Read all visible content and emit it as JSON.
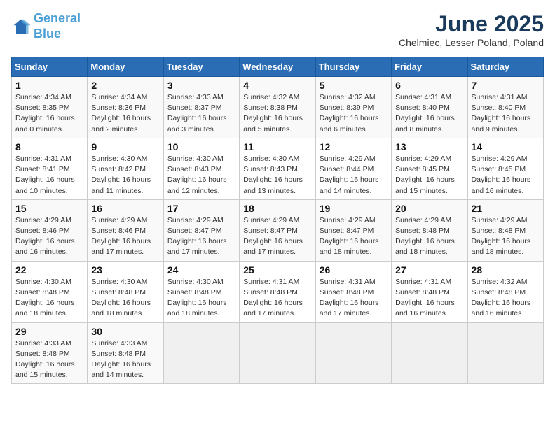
{
  "header": {
    "logo_line1": "General",
    "logo_line2": "Blue",
    "month": "June 2025",
    "location": "Chelmiec, Lesser Poland, Poland"
  },
  "weekdays": [
    "Sunday",
    "Monday",
    "Tuesday",
    "Wednesday",
    "Thursday",
    "Friday",
    "Saturday"
  ],
  "weeks": [
    [
      {
        "day": "1",
        "info": "Sunrise: 4:34 AM\nSunset: 8:35 PM\nDaylight: 16 hours\nand 0 minutes."
      },
      {
        "day": "2",
        "info": "Sunrise: 4:34 AM\nSunset: 8:36 PM\nDaylight: 16 hours\nand 2 minutes."
      },
      {
        "day": "3",
        "info": "Sunrise: 4:33 AM\nSunset: 8:37 PM\nDaylight: 16 hours\nand 3 minutes."
      },
      {
        "day": "4",
        "info": "Sunrise: 4:32 AM\nSunset: 8:38 PM\nDaylight: 16 hours\nand 5 minutes."
      },
      {
        "day": "5",
        "info": "Sunrise: 4:32 AM\nSunset: 8:39 PM\nDaylight: 16 hours\nand 6 minutes."
      },
      {
        "day": "6",
        "info": "Sunrise: 4:31 AM\nSunset: 8:40 PM\nDaylight: 16 hours\nand 8 minutes."
      },
      {
        "day": "7",
        "info": "Sunrise: 4:31 AM\nSunset: 8:40 PM\nDaylight: 16 hours\nand 9 minutes."
      }
    ],
    [
      {
        "day": "8",
        "info": "Sunrise: 4:31 AM\nSunset: 8:41 PM\nDaylight: 16 hours\nand 10 minutes."
      },
      {
        "day": "9",
        "info": "Sunrise: 4:30 AM\nSunset: 8:42 PM\nDaylight: 16 hours\nand 11 minutes."
      },
      {
        "day": "10",
        "info": "Sunrise: 4:30 AM\nSunset: 8:43 PM\nDaylight: 16 hours\nand 12 minutes."
      },
      {
        "day": "11",
        "info": "Sunrise: 4:30 AM\nSunset: 8:43 PM\nDaylight: 16 hours\nand 13 minutes."
      },
      {
        "day": "12",
        "info": "Sunrise: 4:29 AM\nSunset: 8:44 PM\nDaylight: 16 hours\nand 14 minutes."
      },
      {
        "day": "13",
        "info": "Sunrise: 4:29 AM\nSunset: 8:45 PM\nDaylight: 16 hours\nand 15 minutes."
      },
      {
        "day": "14",
        "info": "Sunrise: 4:29 AM\nSunset: 8:45 PM\nDaylight: 16 hours\nand 16 minutes."
      }
    ],
    [
      {
        "day": "15",
        "info": "Sunrise: 4:29 AM\nSunset: 8:46 PM\nDaylight: 16 hours\nand 16 minutes."
      },
      {
        "day": "16",
        "info": "Sunrise: 4:29 AM\nSunset: 8:46 PM\nDaylight: 16 hours\nand 17 minutes."
      },
      {
        "day": "17",
        "info": "Sunrise: 4:29 AM\nSunset: 8:47 PM\nDaylight: 16 hours\nand 17 minutes."
      },
      {
        "day": "18",
        "info": "Sunrise: 4:29 AM\nSunset: 8:47 PM\nDaylight: 16 hours\nand 17 minutes."
      },
      {
        "day": "19",
        "info": "Sunrise: 4:29 AM\nSunset: 8:47 PM\nDaylight: 16 hours\nand 18 minutes."
      },
      {
        "day": "20",
        "info": "Sunrise: 4:29 AM\nSunset: 8:48 PM\nDaylight: 16 hours\nand 18 minutes."
      },
      {
        "day": "21",
        "info": "Sunrise: 4:29 AM\nSunset: 8:48 PM\nDaylight: 16 hours\nand 18 minutes."
      }
    ],
    [
      {
        "day": "22",
        "info": "Sunrise: 4:30 AM\nSunset: 8:48 PM\nDaylight: 16 hours\nand 18 minutes."
      },
      {
        "day": "23",
        "info": "Sunrise: 4:30 AM\nSunset: 8:48 PM\nDaylight: 16 hours\nand 18 minutes."
      },
      {
        "day": "24",
        "info": "Sunrise: 4:30 AM\nSunset: 8:48 PM\nDaylight: 16 hours\nand 18 minutes."
      },
      {
        "day": "25",
        "info": "Sunrise: 4:31 AM\nSunset: 8:48 PM\nDaylight: 16 hours\nand 17 minutes."
      },
      {
        "day": "26",
        "info": "Sunrise: 4:31 AM\nSunset: 8:48 PM\nDaylight: 16 hours\nand 17 minutes."
      },
      {
        "day": "27",
        "info": "Sunrise: 4:31 AM\nSunset: 8:48 PM\nDaylight: 16 hours\nand 16 minutes."
      },
      {
        "day": "28",
        "info": "Sunrise: 4:32 AM\nSunset: 8:48 PM\nDaylight: 16 hours\nand 16 minutes."
      }
    ],
    [
      {
        "day": "29",
        "info": "Sunrise: 4:33 AM\nSunset: 8:48 PM\nDaylight: 16 hours\nand 15 minutes."
      },
      {
        "day": "30",
        "info": "Sunrise: 4:33 AM\nSunset: 8:48 PM\nDaylight: 16 hours\nand 14 minutes."
      },
      {
        "day": "",
        "info": ""
      },
      {
        "day": "",
        "info": ""
      },
      {
        "day": "",
        "info": ""
      },
      {
        "day": "",
        "info": ""
      },
      {
        "day": "",
        "info": ""
      }
    ]
  ]
}
